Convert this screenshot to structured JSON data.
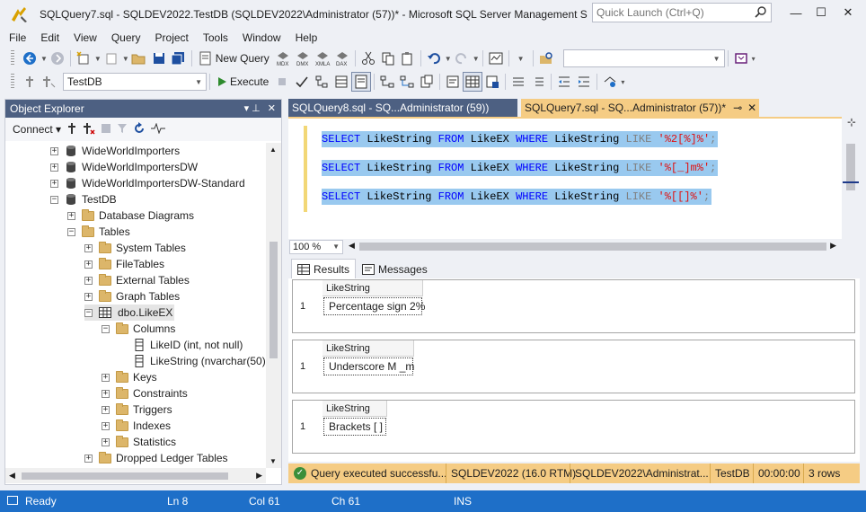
{
  "window": {
    "title": "SQLQuery7.sql - SQLDEV2022.TestDB (SQLDEV2022\\Administrator (57))* - Microsoft SQL Server Management Studi...",
    "quick_launch_placeholder": "Quick Launch (Ctrl+Q)",
    "minimize": "—",
    "maximize": "☐",
    "close": "✕"
  },
  "menu": [
    "File",
    "Edit",
    "View",
    "Query",
    "Project",
    "Tools",
    "Window",
    "Help"
  ],
  "toolbar": {
    "new_query_label": "New Query",
    "database": "TestDB",
    "execute_label": "Execute"
  },
  "object_explorer": {
    "title": "Object Explorer",
    "pin": "▾  ⊥",
    "close": "✕",
    "connect_label": "Connect ▾",
    "tree": [
      {
        "label": "WideWorldImporters",
        "level": 0,
        "icon": "database-icon",
        "expander": "+"
      },
      {
        "label": "WideWorldImportersDW",
        "level": 0,
        "icon": "database-icon",
        "expander": "+"
      },
      {
        "label": "WideWorldImportersDW-Standard",
        "level": 0,
        "icon": "database-icon",
        "expander": "+"
      },
      {
        "label": "TestDB",
        "level": 0,
        "icon": "database-icon",
        "expander": "−"
      },
      {
        "label": "Database Diagrams",
        "level": 1,
        "icon": "folder-icon",
        "expander": "+"
      },
      {
        "label": "Tables",
        "level": 1,
        "icon": "folder-icon",
        "expander": "−"
      },
      {
        "label": "System Tables",
        "level": 2,
        "icon": "folder-icon",
        "expander": "+"
      },
      {
        "label": "FileTables",
        "level": 2,
        "icon": "folder-icon",
        "expander": "+"
      },
      {
        "label": "External Tables",
        "level": 2,
        "icon": "folder-icon",
        "expander": "+"
      },
      {
        "label": "Graph Tables",
        "level": 2,
        "icon": "folder-icon",
        "expander": "+"
      },
      {
        "label": "dbo.LikeEX",
        "level": 2,
        "icon": "table-icon",
        "expander": "−",
        "selected": true
      },
      {
        "label": "Columns",
        "level": 3,
        "icon": "folder-icon",
        "expander": "−"
      },
      {
        "label": "LikeID (int, not null)",
        "level": 4,
        "icon": "column-icon",
        "expander": ""
      },
      {
        "label": "LikeString (nvarchar(50),",
        "level": 4,
        "icon": "column-icon",
        "expander": ""
      },
      {
        "label": "Keys",
        "level": 3,
        "icon": "folder-icon",
        "expander": "+"
      },
      {
        "label": "Constraints",
        "level": 3,
        "icon": "folder-icon",
        "expander": "+"
      },
      {
        "label": "Triggers",
        "level": 3,
        "icon": "folder-icon",
        "expander": "+"
      },
      {
        "label": "Indexes",
        "level": 3,
        "icon": "folder-icon",
        "expander": "+"
      },
      {
        "label": "Statistics",
        "level": 3,
        "icon": "folder-icon",
        "expander": "+"
      },
      {
        "label": "Dropped Ledger Tables",
        "level": 2,
        "icon": "folder-icon",
        "expander": "+"
      }
    ]
  },
  "tabs": [
    {
      "label": "SQLQuery8.sql - SQ...Administrator (59))"
    },
    {
      "label": "SQLQuery7.sql - SQ...Administrator (57))*",
      "pin": "⊸",
      "close": "✕"
    }
  ],
  "editor": {
    "lines": [
      {
        "select": "SELECT",
        "col": "LikeString",
        "from": "FROM",
        "table": "LikeEX",
        "where": "WHERE",
        "col2": "LikeString",
        "like": "LIKE",
        "pattern": "'%2[%]%'",
        "end": ";"
      },
      {
        "select": "SELECT",
        "col": "LikeString",
        "from": "FROM",
        "table": "LikeEX",
        "where": "WHERE",
        "col2": "LikeString",
        "like": "LIKE",
        "pattern": "'%[_]m%'",
        "end": ";"
      },
      {
        "select": "SELECT",
        "col": "LikeString",
        "from": "FROM",
        "table": "LikeEX",
        "where": "WHERE",
        "col2": "LikeString",
        "like": "LIKE",
        "pattern": "'%[[]%'",
        "end": ";"
      }
    ],
    "zoom": "100 %"
  },
  "results": {
    "tabs": [
      "Results",
      "Messages"
    ],
    "grids": [
      {
        "column": "LikeString",
        "row_num": "1",
        "value": "Percentage sign 2%"
      },
      {
        "column": "LikeString",
        "row_num": "1",
        "value": "Underscore M _m"
      },
      {
        "column": "LikeString",
        "row_num": "1",
        "value": "Brackets [ ]"
      }
    ]
  },
  "query_status": {
    "message": "Query executed successfu...",
    "server": "SQLDEV2022 (16.0 RTM)",
    "user": "SQLDEV2022\\Administrat...",
    "database": "TestDB",
    "elapsed": "00:00:00",
    "rows": "3 rows"
  },
  "status_bar": {
    "state": "Ready",
    "line": "Ln 8",
    "col": "Col 61",
    "ch": "Ch 61",
    "mode": "INS"
  },
  "colors": {
    "accent_blue": "#1e6fc8",
    "active_tab": "#f5cc84",
    "panel_header": "#4d6082",
    "selection": "#99c9ef"
  }
}
